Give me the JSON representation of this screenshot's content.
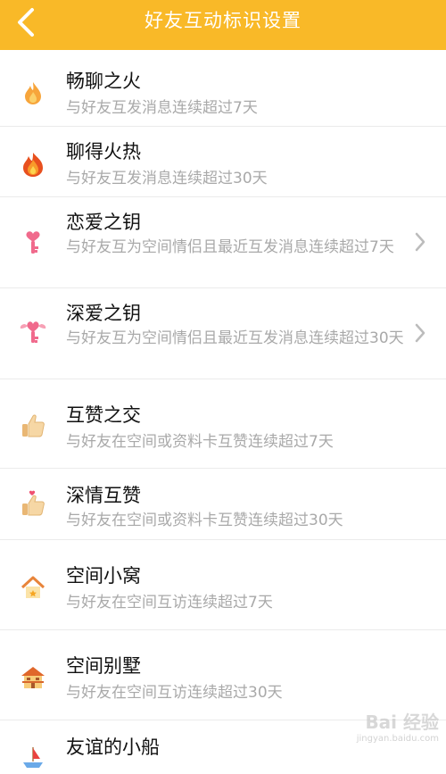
{
  "header": {
    "title": "好友互动标识设置",
    "back_icon": "chevron-left-icon",
    "background": "#f9b928"
  },
  "items": [
    {
      "title": "畅聊之火",
      "desc": "与好友互发消息连续超过7天",
      "icon": "small-flame-icon"
    },
    {
      "title": "聊得火热",
      "desc": "与好友互发消息连续超过30天",
      "icon": "big-flame-icon"
    },
    {
      "title": "恋爱之钥",
      "desc": "与好友互为空间情侣且最近互发消息连续超过7天",
      "icon": "heart-key-icon",
      "chevron": true
    },
    {
      "title": "深爱之钥",
      "desc": "与好友互为空间情侣且最近互发消息连续超过30天",
      "icon": "winged-heart-key-icon",
      "chevron": true
    },
    {
      "title": "互赞之交",
      "desc": "与好友在空间或资料卡互赞连续超过7天",
      "icon": "thumbs-up-icon"
    },
    {
      "title": "深情互赞",
      "desc": "与好友在空间或资料卡互赞连续超过30天",
      "icon": "thumbs-up-heart-icon"
    },
    {
      "title": "空间小窝",
      "desc": "与好友在空间互访连续超过7天",
      "icon": "small-house-icon"
    },
    {
      "title": "空间别墅",
      "desc": "与好友在空间互访连续超过30天",
      "icon": "villa-icon"
    },
    {
      "title": "友谊的小船",
      "desc": "",
      "icon": "boat-icon"
    }
  ],
  "watermark": {
    "main": "Bai 经验",
    "sub": "jingyan.baidu.com"
  }
}
